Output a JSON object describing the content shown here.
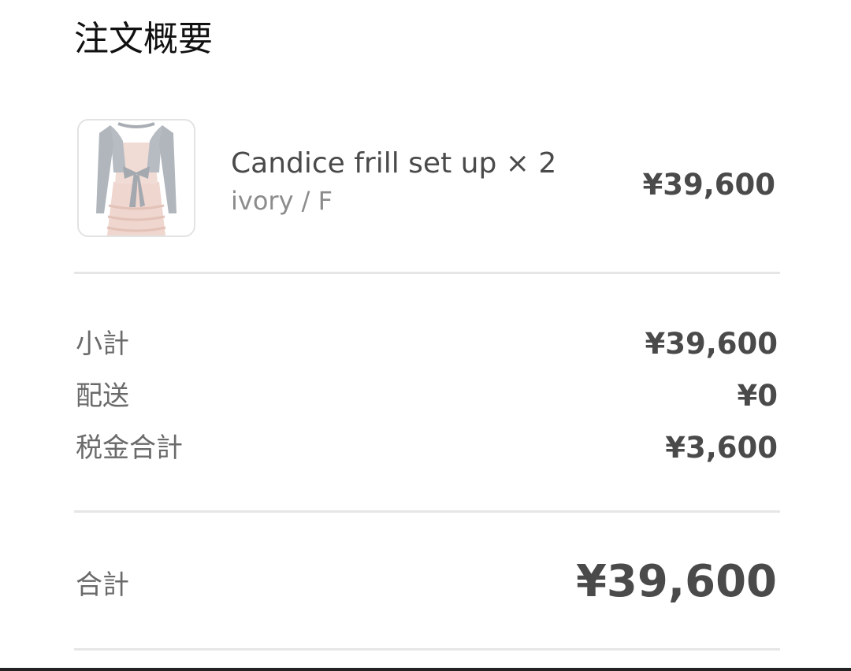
{
  "summary": {
    "title": "注文概要"
  },
  "item": {
    "name": "Candice frill set up × 2",
    "variant": "ivory / F",
    "price": "¥39,600",
    "image_icon": "product-thumbnail-dress"
  },
  "totals": {
    "subtotal_label": "小計",
    "subtotal_value": "¥39,600",
    "shipping_label": "配送",
    "shipping_value": "¥0",
    "tax_label": "税金合計",
    "tax_value": "¥3,600",
    "total_label": "合計",
    "total_value": "¥39,600"
  },
  "colors": {
    "text_dark": "#111111",
    "text_body": "#4a4a4a",
    "text_muted": "#8c8c8c",
    "divider": "#e6e6e6"
  }
}
